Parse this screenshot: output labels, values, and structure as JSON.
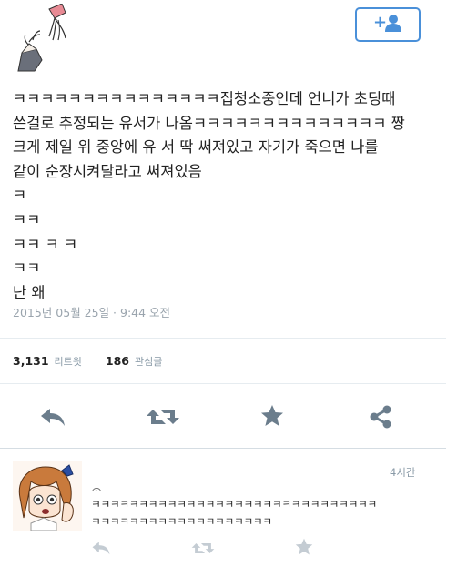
{
  "tweet": {
    "text": "ㅋㅋㅋㅋㅋㅋㅋㅋㅋㅋㅋㅋㅋㅋㅋ집청소중인데 언니가 초딩때\n쓴걸로 추정되는 유서가 나옴ㅋㅋㅋㅋㅋㅋㅋㅋㅋㅋㅋㅋㅋㅋ 짱\n크게 제일 위 중앙에 유 서 딱 써져있고 자기가 죽으면 나를\n같이 순장시켜달라고 써져있음\nㅋ\nㅋㅋ\nㅋㅋ ㅋ ㅋ\nㅋㅋ\n난 왜",
    "timestamp": "2015년 05월 25일 · 9:44 오전",
    "retweets_count": "3,131",
    "retweets_label": "리트윗",
    "favorites_count": "186",
    "favorites_label": "관심글"
  },
  "icons": {
    "follow": "add-user-icon",
    "reply": "reply-icon",
    "retweet": "retweet-icon",
    "favorite": "star-icon",
    "share": "share-icon"
  },
  "reply_tweet": {
    "time": "4시간",
    "handle": "@...",
    "text": "ㅋㅋㅋㅋㅋㅋㅋㅋㅋㅋㅋㅋㅋㅋㅋㅋㅋㅋㅋㅋㅋㅋㅋㅋㅋㅋㅋㅋㅋㅋ\nㅋㅋㅋㅋㅋㅋㅋㅋㅋㅋㅋㅋㅋㅋㅋㅋㅋㅋㅋ"
  },
  "colors": {
    "accent": "#4a90d9",
    "action_icon": "#6b7d8c",
    "action_icon_faded": "#c4ccd3",
    "muted_text": "#9aa4ad"
  }
}
